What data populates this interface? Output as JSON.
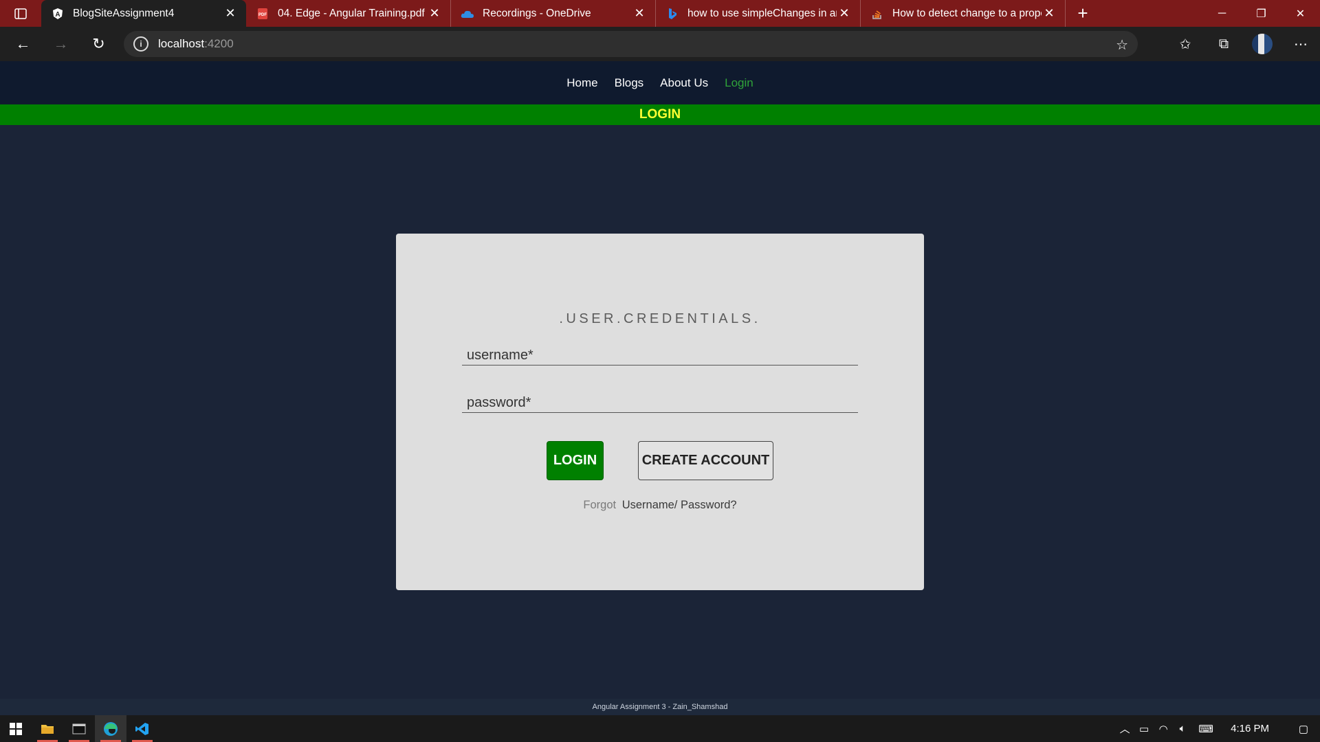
{
  "browser": {
    "tabs": [
      {
        "title": "BlogSiteAssignment4",
        "icon": "angular-icon",
        "active": true
      },
      {
        "title": "04. Edge - Angular Training.pdf",
        "icon": "pdf-icon",
        "active": false
      },
      {
        "title": "Recordings - OneDrive",
        "icon": "onedrive-icon",
        "active": false
      },
      {
        "title": "how to use simpleChanges in an",
        "icon": "bing-icon",
        "active": false
      },
      {
        "title": "How to detect change to a prope",
        "icon": "stackoverflow-icon",
        "active": false
      }
    ],
    "address": {
      "host": "localhost",
      "port": ":4200"
    }
  },
  "site": {
    "nav": [
      "Home",
      "Blogs",
      "About Us",
      "Login"
    ],
    "banner": "LOGIN",
    "card": {
      "heading": ".USER.CREDENTIALS.",
      "username_placeholder": "username*",
      "password_placeholder": "password*",
      "login_label": "LOGIN",
      "create_label": "CREATE ACCOUNT",
      "forgot_prefix": "Forgot",
      "forgot_link": "Username/ Password?"
    },
    "footer": "Angular Assignment 3 - Zain_Shamshad"
  },
  "taskbar": {
    "clock": "4:16 PM"
  },
  "colors": {
    "tabstrip": "#7c1a1a",
    "page_bg": "#1b2437",
    "banner_bg": "#008000",
    "banner_text": "#ffff33",
    "active_nav": "#2fa33a"
  }
}
